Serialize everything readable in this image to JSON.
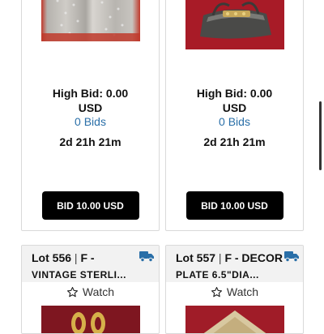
{
  "cards_top": [
    {
      "high_bid": "High Bid: 0.00",
      "currency": "USD",
      "bids": "0 Bids",
      "time_left": "2d 21h 21m",
      "bid_button": "BID 10.00 USD",
      "image": "crystal-rhinestone-item"
    },
    {
      "high_bid": "High Bid: 0.00",
      "currency": "USD",
      "bids": "0 Bids",
      "time_left": "2d 21h 21m",
      "bid_button": "BID 10.00 USD",
      "image": "silver-handbag"
    }
  ],
  "cards_bottom": [
    {
      "lot_label": "Lot 556",
      "separator": "|",
      "category": "F -",
      "title": "VINTAGE STERLI...",
      "watch_label": "Watch",
      "icons": [
        "truck-icon",
        "star-outline-icon"
      ]
    },
    {
      "lot_label": "Lot 557",
      "separator": "|",
      "category": "F - DECOR",
      "title": "PLATE 6.5\"DIA...",
      "watch_label": "Watch",
      "icons": [
        "truck-icon",
        "star-outline-icon"
      ]
    }
  ],
  "colors": {
    "bids_link": "#2a6fa8",
    "button_bg": "#000000",
    "truck": "#2a6fa8"
  }
}
